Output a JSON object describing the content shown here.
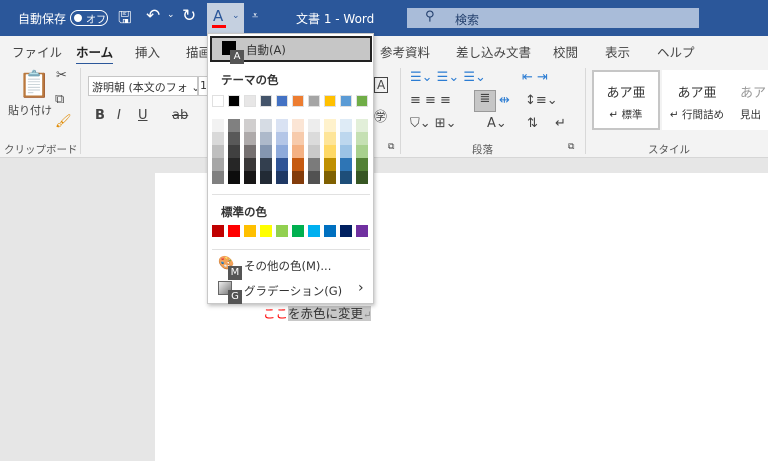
{
  "titlebar": {
    "autosave_label": "自動保存",
    "autosave_state": "オフ",
    "doc_title": "文書 1  -  Word",
    "search_placeholder": "検索",
    "font_color_glyph": "A",
    "font_color_bar": "#ff0000"
  },
  "tabs": [
    "ファイル",
    "ホーム",
    "挿入",
    "描画",
    "参考資料",
    "差し込み文書",
    "校閲",
    "表示",
    "ヘルプ"
  ],
  "ribbon": {
    "clipboard": {
      "paste": "貼り付け",
      "group": "クリップボード"
    },
    "font": {
      "name": "游明朝 (本文のフォ",
      "size": "1",
      "bold": "B",
      "italic": "I",
      "underline": "U",
      "strike": "ab"
    },
    "paragraph": {
      "group": "段落"
    },
    "styles": {
      "items": [
        {
          "preview": "あア亜",
          "name": "↵ 標準"
        },
        {
          "preview": "あア亜",
          "name": "↵ 行間詰め"
        },
        {
          "preview": "あア",
          "name": "見出"
        }
      ],
      "group": "スタイル"
    }
  },
  "menu": {
    "auto": {
      "label": "自動(A)",
      "key": "A"
    },
    "theme_heading": "テーマの色",
    "theme_colors": [
      "#ffffff",
      "#000000",
      "#e7e6e6",
      "#44546a",
      "#4472c4",
      "#ed7d31",
      "#a5a5a5",
      "#ffc000",
      "#5b9bd5",
      "#70ad47"
    ],
    "theme_shades": [
      [
        "#f2f2f2",
        "#d9d9d9",
        "#bfbfbf",
        "#a6a6a6",
        "#808080"
      ],
      [
        "#808080",
        "#595959",
        "#404040",
        "#262626",
        "#0d0d0d"
      ],
      [
        "#d0cece",
        "#aeaaaa",
        "#757070",
        "#3a3838",
        "#171616"
      ],
      [
        "#d6dce4",
        "#adb9ca",
        "#8496b0",
        "#333f4f",
        "#222a35"
      ],
      [
        "#d9e2f3",
        "#b4c6e7",
        "#8eaadb",
        "#2f5496",
        "#1f3864"
      ],
      [
        "#fbe5d5",
        "#f7cbac",
        "#f4b183",
        "#c55a11",
        "#833c0b"
      ],
      [
        "#ededed",
        "#dbdbdb",
        "#c9c9c9",
        "#7b7b7b",
        "#525252"
      ],
      [
        "#fff2cc",
        "#fee599",
        "#ffd965",
        "#bf9000",
        "#7f6000"
      ],
      [
        "#deebf6",
        "#bdd7ee",
        "#9cc3e5",
        "#2e75b5",
        "#1e4e79"
      ],
      [
        "#e2efd9",
        "#c5e0b3",
        "#a8d08d",
        "#538135",
        "#375623"
      ]
    ],
    "standard_heading": "標準の色",
    "standard_colors": [
      "#c00000",
      "#ff0000",
      "#ffc000",
      "#ffff00",
      "#92d050",
      "#00b050",
      "#00b0f0",
      "#0070c0",
      "#002060",
      "#7030a0"
    ],
    "more_colors": {
      "label": "その他の色(M)...",
      "key": "M"
    },
    "gradient": {
      "label": "グラデーション(G)",
      "key": "G",
      "arrow": "›"
    }
  },
  "document": {
    "red_text": "ここ",
    "rest_text": "を赤色に変更",
    "mark": "↵",
    "red": "#ff0000"
  }
}
